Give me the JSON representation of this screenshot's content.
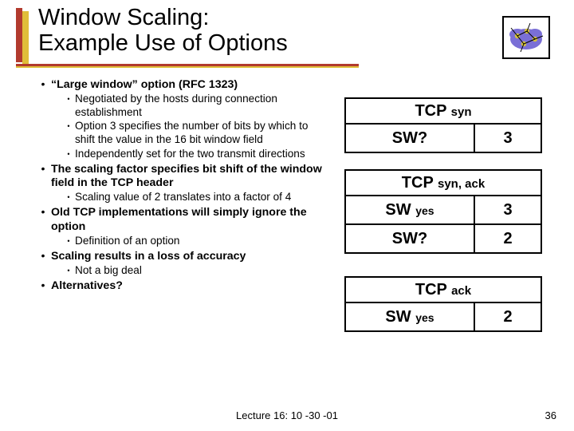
{
  "title_line1": "Window Scaling:",
  "title_line2": "Example Use of Options",
  "bullets": [
    {
      "level": 1,
      "text": "“Large window” option (RFC 1323)",
      "bold": true
    },
    {
      "level": 2,
      "text": "Negotiated by the hosts during connection establishment"
    },
    {
      "level": 2,
      "text": "Option 3 specifies the number of bits by which to shift the value in the 16 bit window field"
    },
    {
      "level": 2,
      "text": "Independently set for the two transmit directions"
    },
    {
      "level": 1,
      "text": "The scaling factor specifies bit shift of the window field in the TCP header",
      "bold": true
    },
    {
      "level": 2,
      "text": "Scaling value of 2 translates into a factor of 4"
    },
    {
      "level": 1,
      "text": "Old TCP implementations will simply ignore the option",
      "bold": true
    },
    {
      "level": 2,
      "text": "Definition of an option"
    },
    {
      "level": 1,
      "text": "Scaling results in a loss of accuracy",
      "bold": true
    },
    {
      "level": 2,
      "text": "Not a big deal"
    },
    {
      "level": 1,
      "text": "Alternatives?",
      "bold": true
    }
  ],
  "packets": [
    {
      "label_main": "TCP",
      "label_sub": "syn",
      "rows": [
        {
          "left_main": "SW?",
          "left_sub": "",
          "right": "3"
        }
      ]
    },
    {
      "label_main": "TCP",
      "label_sub": "syn, ack",
      "rows": [
        {
          "left_main": "SW",
          "left_sub": "yes",
          "right": "3"
        },
        {
          "left_main": "SW?",
          "left_sub": "",
          "right": "2"
        }
      ]
    },
    {
      "label_main": "TCP",
      "label_sub": "ack",
      "rows": [
        {
          "left_main": "SW",
          "left_sub": "yes",
          "right": "2"
        }
      ]
    }
  ],
  "footer": "Lecture 16: 10 -30 -01",
  "pagenum": "36"
}
